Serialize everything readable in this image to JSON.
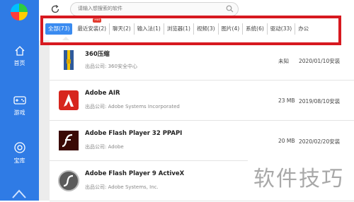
{
  "search": {
    "placeholder": "请输入想搜索的软件"
  },
  "sidebar": {
    "items": [
      {
        "label": "首页",
        "icon": "home-icon"
      },
      {
        "label": "游戏",
        "icon": "gamepad-icon"
      },
      {
        "label": "宝库",
        "icon": "treasure-icon"
      }
    ]
  },
  "tabs": [
    {
      "label": "全部(73)",
      "active": true
    },
    {
      "label": "最近安装(2)",
      "badge": "Hot"
    },
    {
      "label": "聊天(2)"
    },
    {
      "label": "输入法(1)"
    },
    {
      "label": "浏览器(1)"
    },
    {
      "label": "视频(3)"
    },
    {
      "label": "图片(4)"
    },
    {
      "label": "系统(6)"
    },
    {
      "label": "驱动(33)"
    },
    {
      "label": "办公"
    }
  ],
  "software": [
    {
      "name": "360压缩",
      "publisher": "出品公司: 360安全中心",
      "size": "未知",
      "date": "2020/01/10安装",
      "icon": "zip-archive-icon"
    },
    {
      "name": "Adobe AIR",
      "publisher": "出品公司: Adobe Systems Incorporated",
      "size": "23 MB",
      "date": "2019/08/10安装",
      "icon": "adobe-air-icon"
    },
    {
      "name": "Adobe Flash Player 32 PPAPI",
      "publisher": "出品公司: Adobe",
      "size": "20 MB",
      "date": "2020/02/20安装",
      "icon": "flash-player-icon"
    },
    {
      "name": "Adobe Flash Player 9 ActiveX",
      "publisher": "出品公司: Adobe Systems, Inc.",
      "size": "",
      "date": "",
      "icon": "flash-player-gray-icon"
    }
  ],
  "watermark": "软件技巧",
  "colors": {
    "sidebar": "#2f7be5",
    "active_tab": "#3a8bf0",
    "highlight": "#d71920"
  }
}
